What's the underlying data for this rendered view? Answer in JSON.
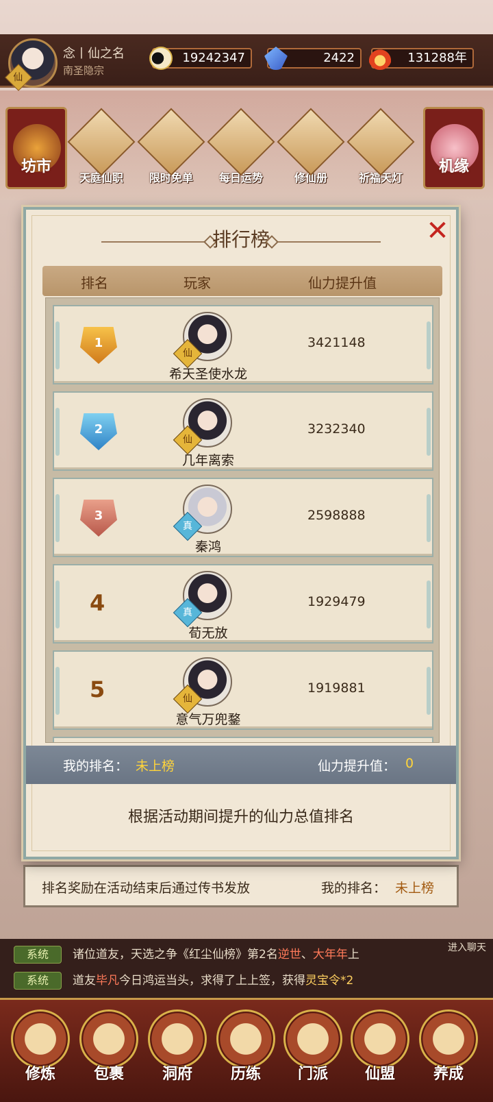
{
  "header": {
    "player_name": "念丨仙之名",
    "sect": "南圣隐宗",
    "avatar_badge": "仙",
    "resources": [
      {
        "icon": "yin-yang-icon",
        "value": "19242347"
      },
      {
        "icon": "crystal-icon",
        "value": "2422"
      },
      {
        "icon": "flame-icon",
        "value": "131288年"
      }
    ]
  },
  "top_menu": {
    "left_banner": "坊市",
    "right_banner": "机缘",
    "items": [
      "天庭仙职",
      "限时免单",
      "每日运势",
      "修仙册",
      "祈福天灯"
    ]
  },
  "modal": {
    "title": "排行榜",
    "columns": [
      "排名",
      "玩家",
      "仙力提升值"
    ],
    "rows": [
      {
        "rank": "1",
        "name": "希天圣使水龙",
        "badge": "仙",
        "value": "3421148"
      },
      {
        "rank": "2",
        "name": "几年离索",
        "badge": "仙",
        "value": "3232340"
      },
      {
        "rank": "3",
        "name": "秦鸿",
        "badge": "真",
        "value": "2598888"
      },
      {
        "rank": "4",
        "name": "荀无放",
        "badge": "真",
        "value": "1929479"
      },
      {
        "rank": "5",
        "name": "意气万兜鍪",
        "badge": "仙",
        "value": "1919881"
      }
    ],
    "my_rank_label": "我的排名：",
    "my_rank_value": "未上榜",
    "my_power_label": "仙力提升值：",
    "my_power_value": "0",
    "description": "根据活动期间提升的仙力总值排名"
  },
  "under_panel": {
    "note": "排名奖励在活动结束后通过传书发放",
    "my_rank_label": "我的排名：",
    "my_rank_value": "未上榜"
  },
  "chat": {
    "enter_label": "进入聊天",
    "lines": [
      {
        "tag": "系统",
        "p1": "诸位道友，天选之争《红尘仙榜》第2名",
        "hl1": "逆世",
        "p2": "、",
        "hl2": "大年年",
        "p3": "上"
      },
      {
        "tag": "系统",
        "p1": "道友",
        "hl1": "毕凡",
        "p2": "今日鸿运当头，求得了上上签，获得",
        "hl2": "灵宝令*2",
        "p3": ""
      }
    ]
  },
  "bottom_nav": [
    "修炼",
    "包裹",
    "洞府",
    "历练",
    "门派",
    "仙盟",
    "养成"
  ]
}
